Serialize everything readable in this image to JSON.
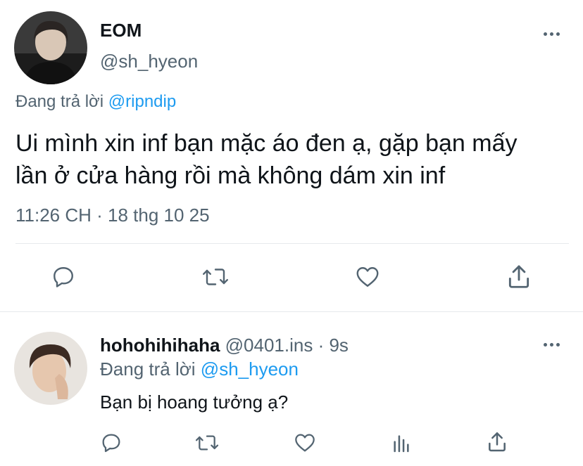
{
  "main_tweet": {
    "display_name": "EOM",
    "handle": "@sh_hyeon",
    "replying_to_label": "Đang trả lời",
    "replying_to_user": "@ripndip",
    "text_line1": "Ui mình xin inf bạn mặc áo đen ạ, gặp bạn mấy",
    "text_line2": "lần ở cửa hàng rồi mà không dám xin inf",
    "timestamp": "11:26 CH · 18 thg 10 25"
  },
  "reply_tweet": {
    "display_name": "hohohihihaha",
    "handle_time": "@0401.ins · 9s",
    "replying_to_label": "Đang trả lời",
    "replying_to_user": "@sh_hyeon",
    "text": "Bạn bị hoang tưởng ạ?"
  },
  "icons": {
    "more": "more-horizontal-icon",
    "reply": "reply-bubble-icon",
    "retweet": "retweet-icon",
    "like": "heart-icon",
    "views": "analytics-bars-icon",
    "share": "share-upload-icon"
  },
  "colors": {
    "link": "#1d9bf0",
    "secondary_text": "#536471",
    "primary_text": "#0f1419",
    "divider": "#e6e9ec"
  }
}
